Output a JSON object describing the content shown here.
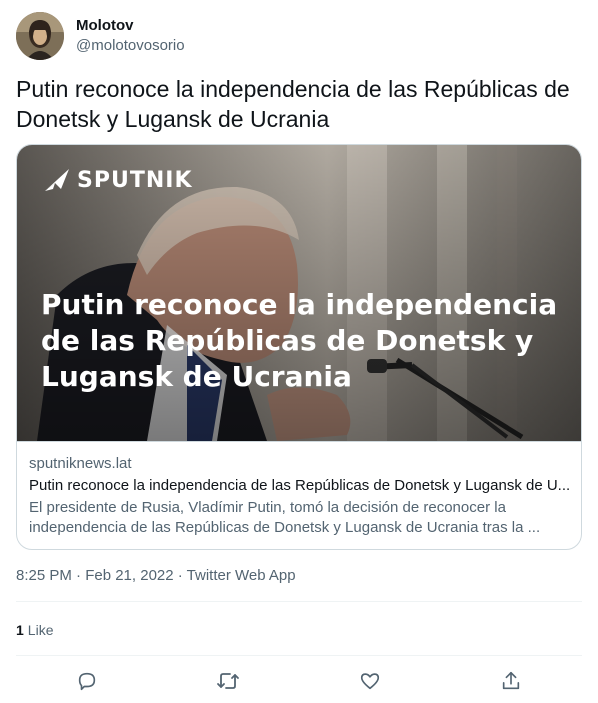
{
  "author": {
    "display_name": "Molotov",
    "handle": "@molotovosorio"
  },
  "tweet": {
    "text": "Putin reconoce la independencia de las Repúblicas de Donetsk y Lugansk de Ucrania",
    "timestamp": "8:25 PM · Feb 21, 2022 · Twitter Web App"
  },
  "card": {
    "brand": "SPUTNIK",
    "overlay_title": "Putin reconoce la independencia de las Repúblicas de Donetsk y Lugansk de Ucrania",
    "domain": "sputniknews.lat",
    "title": "Putin reconoce la independencia de las Repúblicas de Donetsk y Lugansk de U...",
    "description": "El presidente de Rusia, Vladímir Putin, tomó la decisión de reconocer la independencia de las Repúblicas de Donetsk y Lugansk de Ucrania tras la ..."
  },
  "stats": {
    "likes_count": "1",
    "likes_label": "Like"
  },
  "actions": {
    "reply_icon": "reply-icon",
    "retweet_icon": "retweet-icon",
    "like_icon": "like-icon",
    "share_icon": "share-icon"
  },
  "colors": {
    "text_primary": "#0f1419",
    "text_secondary": "#536471",
    "border": "#cfd9de",
    "divider": "#eff3f4"
  }
}
